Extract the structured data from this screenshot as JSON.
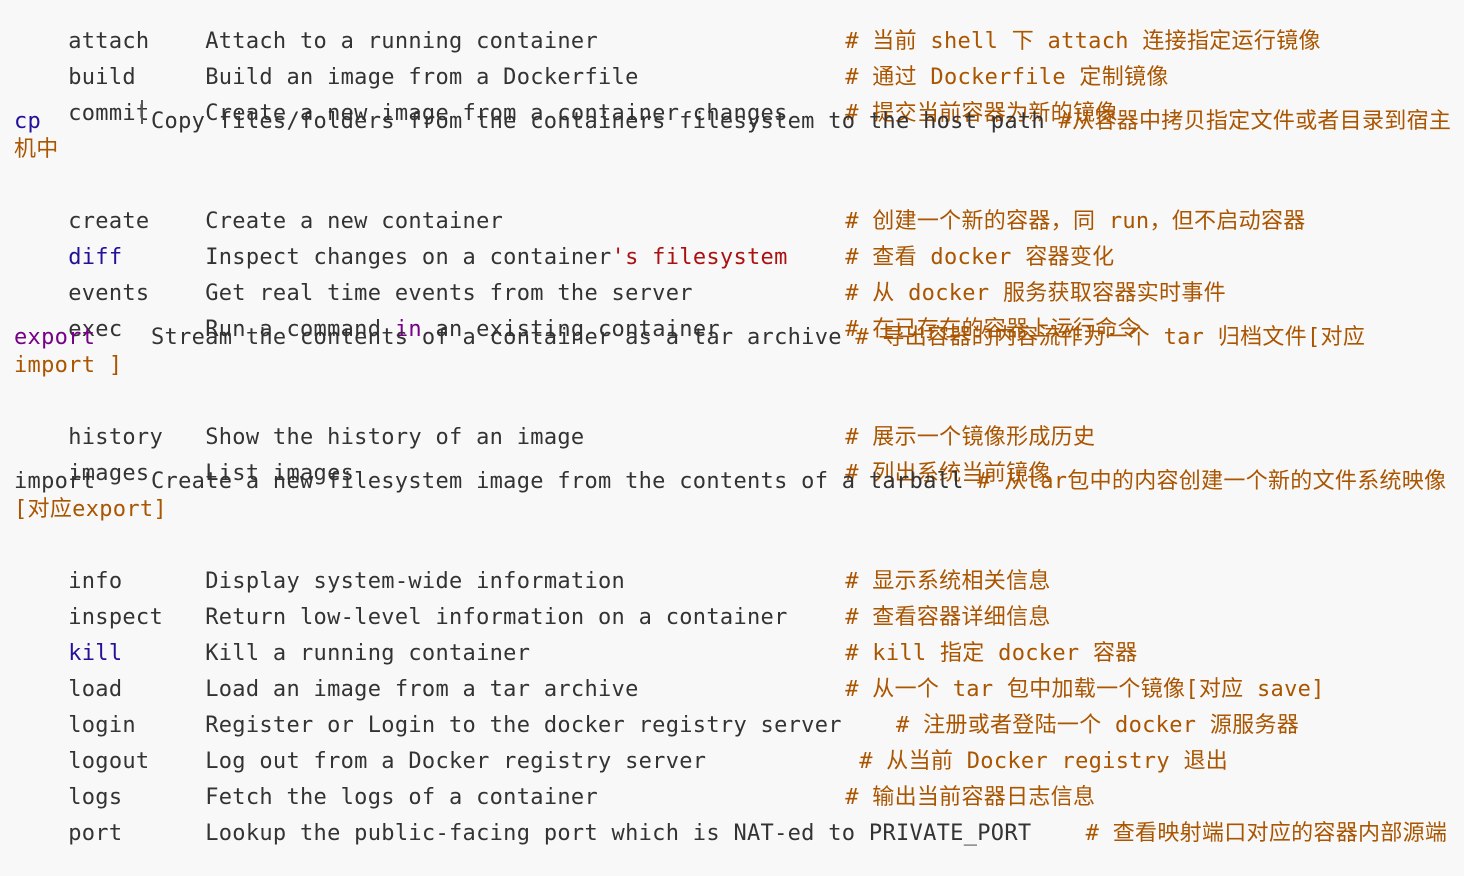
{
  "lines": [
    {
      "cmd": "attach",
      "desc": "Attach to a running container",
      "comment": "# 当前 shell 下 attach 连接指定运行镜像"
    },
    {
      "cmd": "build",
      "desc": "Build an image from a Dockerfile",
      "comment": "# 通过 Dockerfile 定制镜像"
    },
    {
      "cmd": "commit",
      "desc": "Create a new image from a container changes",
      "comment": "# 提交当前容器为新的镜像"
    },
    {
      "cmd": "cp",
      "desc": "Copy files/folders from the containers filesystem to the host path",
      "comment": "#从容器中拷贝指定文件或者目录到宿主机中"
    },
    {
      "cmd": "create",
      "desc": "Create a new container",
      "comment": "# 创建一个新的容器，同 run，但不启动容器"
    },
    {
      "cmd": "diff",
      "desc_a": "Inspect changes on a container",
      "desc_b": "'s filesystem",
      "comment": "# 查看 docker 容器变化"
    },
    {
      "cmd": "events",
      "desc": "Get real time events from the server",
      "comment": "# 从 docker 服务获取容器实时事件"
    },
    {
      "cmd": "exec",
      "desc_a": "Run a command ",
      "desc_kw": "in",
      "desc_b": " an existing container",
      "comment": "# 在已存在的容器上运行命令"
    },
    {
      "cmd": "export",
      "desc": "Stream the contents of a container as a tar archive",
      "comment": "# 导出容器的内容流作为一个 tar 归档文件[对应 import ]"
    },
    {
      "cmd": "history",
      "desc": "Show the history of an image",
      "comment": "# 展示一个镜像形成历史"
    },
    {
      "cmd": "images",
      "desc": "List images",
      "comment": "# 列出系统当前镜像"
    },
    {
      "cmd": "import",
      "desc": "Create a new filesystem image from the contents of a tarball",
      "comment": "# 从tar包中的内容创建一个新的文件系统映像[对应export]"
    },
    {
      "cmd": "info",
      "desc": "Display system-wide information",
      "comment": "# 显示系统相关信息"
    },
    {
      "cmd": "inspect",
      "desc": "Return low-level information on a container",
      "comment": "# 查看容器详细信息"
    },
    {
      "cmd": "kill",
      "desc": "Kill a running container",
      "comment": "# kill 指定 docker 容器"
    },
    {
      "cmd": "load",
      "desc": "Load an image from a tar archive",
      "comment": "# 从一个 tar 包中加载一个镜像[对应 save]"
    },
    {
      "cmd": "login",
      "desc": "Register or Login to the docker registry server",
      "comment": "# 注册或者登陆一个 docker 源服务器"
    },
    {
      "cmd": "logout",
      "desc": "Log out from a Docker registry server",
      "comment": "# 从当前 Docker registry 退出"
    },
    {
      "cmd": "logs",
      "desc": "Fetch the logs of a container",
      "comment": "# 输出当前容器日志信息"
    },
    {
      "cmd": "port",
      "desc": "Lookup the public-facing port which is NAT-ed to PRIVATE_PORT",
      "comment": "# 查看映射端口对应的容器内部源端"
    }
  ],
  "colors": {
    "comment": "#aa5500",
    "keyword_purple": "#770088",
    "keyword_blue": "#0000ff",
    "keyword_navy": "#221199",
    "string": "#aa1111",
    "text": "#333333",
    "background": "#f8f8f8"
  }
}
